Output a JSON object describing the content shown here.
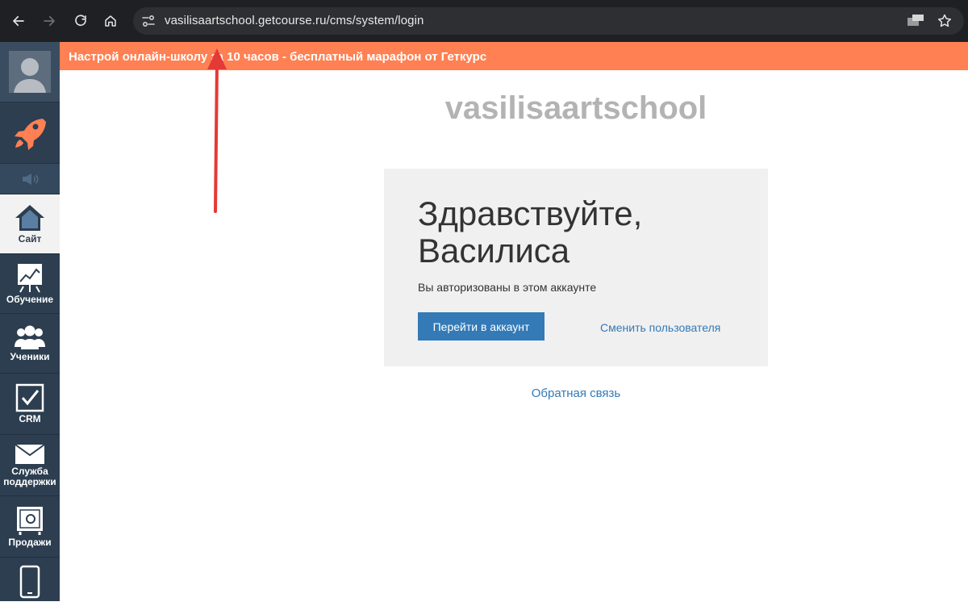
{
  "browser": {
    "url": "vasilisaartschool.getcourse.ru/cms/system/login"
  },
  "banner": {
    "text": "Настрой онлайн-школу за 10 часов - бесплатный марафон от Геткурс"
  },
  "sidebar": {
    "items": [
      {
        "label": "Сайт",
        "icon": "home-icon"
      },
      {
        "label": "Обучение",
        "icon": "chart-board-icon"
      },
      {
        "label": "Ученики",
        "icon": "users-icon"
      },
      {
        "label": "CRM",
        "icon": "checkbox-icon"
      },
      {
        "label": "Служба поддержки",
        "icon": "envelope-icon"
      },
      {
        "label": "Продажи",
        "icon": "safe-icon"
      }
    ]
  },
  "main": {
    "school_title": "vasilisaartschool",
    "greeting_line1": "Здравствуйте,",
    "greeting_line2": "Василиса",
    "auth_text": "Вы авторизованы в этом аккаунте",
    "go_account_label": "Перейти в аккаунт",
    "switch_user_label": "Сменить пользователя",
    "feedback_label": "Обратная связь"
  },
  "colors": {
    "banner": "#ff8052",
    "sidebar": "#2c3e50",
    "primary_button": "#337ab7",
    "annotation_arrow": "#e53935"
  }
}
